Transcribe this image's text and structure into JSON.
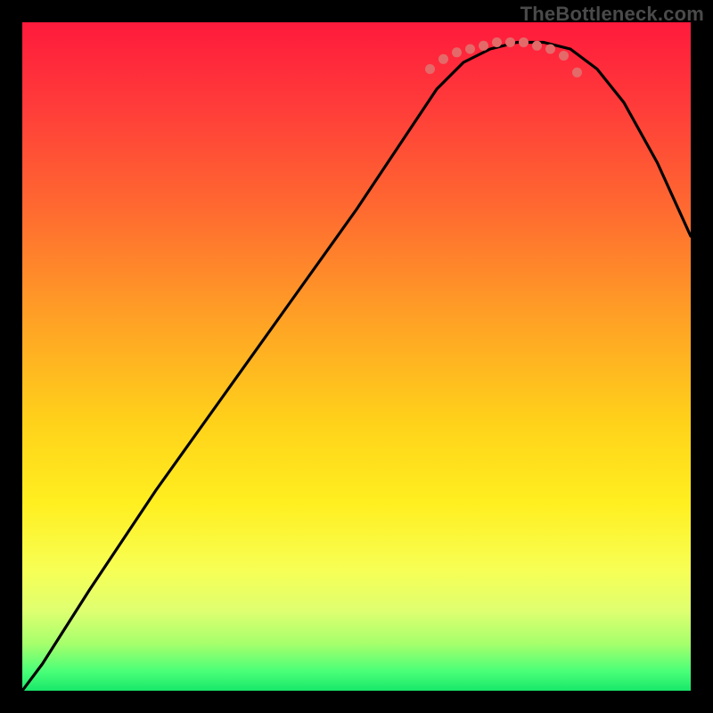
{
  "watermark": "TheBottleneck.com",
  "chart_data": {
    "type": "line",
    "title": "",
    "xlabel": "",
    "ylabel": "",
    "xlim": [
      0,
      100
    ],
    "ylim": [
      0,
      100
    ],
    "series": [
      {
        "name": "bottleneck-curve",
        "x": [
          0,
          3,
          10,
          20,
          30,
          40,
          50,
          58,
          62,
          66,
          70,
          74,
          78,
          82,
          86,
          90,
          95,
          100
        ],
        "y": [
          0,
          4,
          15,
          30,
          44,
          58,
          72,
          84,
          90,
          94,
          96,
          97,
          97,
          96,
          93,
          88,
          79,
          68
        ]
      }
    ],
    "highlight_region": {
      "name": "sweet-spot-dots",
      "x": [
        61,
        63,
        65,
        67,
        69,
        71,
        73,
        75,
        77,
        79,
        81,
        83
      ],
      "y": [
        93,
        94.5,
        95.5,
        96,
        96.5,
        97,
        97,
        97,
        96.5,
        96,
        95,
        92.5
      ]
    },
    "colors": {
      "curve": "#000000",
      "dots": "#e46a6a",
      "gradient_top": "#ff1a3c",
      "gradient_bottom": "#18e86a"
    }
  }
}
